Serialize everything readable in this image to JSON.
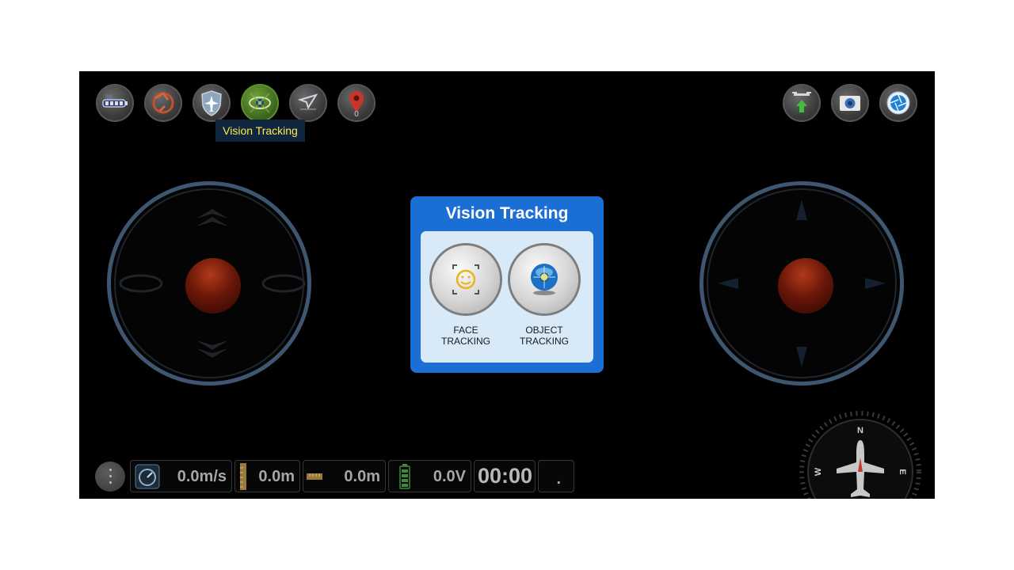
{
  "tooltip": {
    "text": "Vision Tracking"
  },
  "top_toolbar": {
    "left_buttons": [
      {
        "icon": "battery-signal-icon"
      },
      {
        "icon": "rotate-icon"
      },
      {
        "icon": "flight-mode-shield-icon"
      },
      {
        "icon": "vision-tracking-eye-icon",
        "active": true
      },
      {
        "icon": "send-path-icon"
      },
      {
        "icon": "waypoint-pin-icon",
        "count": "0"
      }
    ],
    "right_buttons": [
      {
        "icon": "drone-takeoff-icon"
      },
      {
        "icon": "camera-icon"
      },
      {
        "icon": "shutter-icon"
      }
    ]
  },
  "dialog": {
    "title": "Vision Tracking",
    "options": [
      {
        "label_line1": "FACE",
        "label_line2": "TRACKING",
        "icon": "face-tracking-icon"
      },
      {
        "label_line1": "OBJECT",
        "label_line2": "TRACKING",
        "icon": "object-tracking-icon"
      }
    ]
  },
  "status_bar": {
    "speed": "0.0m/s",
    "height": "0.0m",
    "distance": "0.0m",
    "voltage": "0.0V",
    "timer": "00:00",
    "extra": "."
  },
  "compass": {
    "north": "N",
    "east": "E",
    "west": "W"
  },
  "colors": {
    "dialog_blue": "#1b6fd4",
    "panel": "#d8e9f8",
    "tooltip_bg": "#10263f",
    "tooltip_text": "#ffe949"
  }
}
